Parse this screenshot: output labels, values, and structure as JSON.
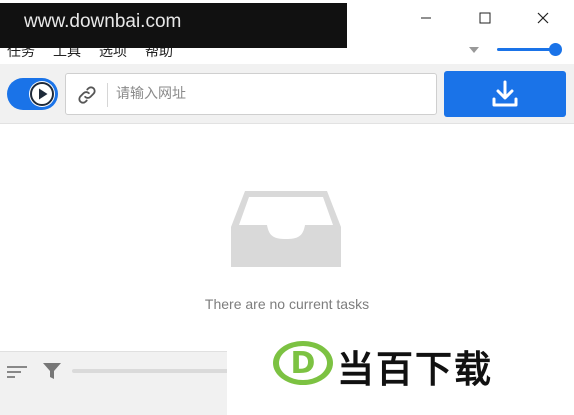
{
  "watermark": {
    "text": "www.downbai.com"
  },
  "window": {
    "minimize_icon": "minimize-icon",
    "maximize_icon": "maximize-icon",
    "close_icon": "close-icon"
  },
  "menu": {
    "items": [
      {
        "label": "任务"
      },
      {
        "label": "工具"
      },
      {
        "label": "选项"
      },
      {
        "label": "帮助"
      }
    ]
  },
  "speed_slider": {
    "level": 0.95
  },
  "toolbar": {
    "url_placeholder": "请输入网址",
    "download_icon": "download-icon",
    "toggle_state": "on"
  },
  "main": {
    "empty_message": "There are no current tasks",
    "empty_icon": "inbox-tray-icon"
  },
  "logo": {
    "mark": "D",
    "text": "当百下载"
  },
  "colors": {
    "accent": "#1a73e8",
    "logo_green": "#7cc242",
    "watermark_bg": "#111111"
  }
}
